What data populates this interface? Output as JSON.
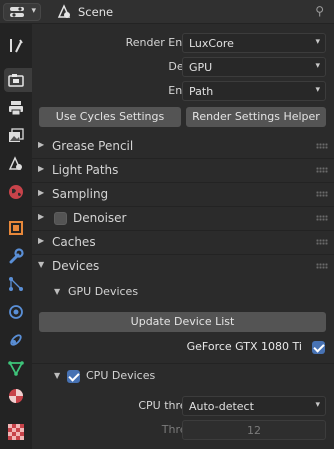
{
  "header": {
    "scene_title": "Scene",
    "editor_icon": "properties-editor-icon",
    "context_icon": "scene-icon",
    "pin_icon": "pin-icon"
  },
  "tabs": [
    {
      "name": "tool-tab",
      "icon": "wrench-screwdriver-icon"
    },
    {
      "name": "render-tab",
      "icon": "camera-back-icon",
      "active": true
    },
    {
      "name": "output-tab",
      "icon": "printer-icon"
    },
    {
      "name": "view-layer-tab",
      "icon": "image-stack-icon"
    },
    {
      "name": "scene-tab",
      "icon": "scene-icon"
    },
    {
      "name": "world-tab",
      "icon": "world-icon"
    },
    {
      "name": "object-tab",
      "icon": "object-square-icon"
    },
    {
      "name": "modifier-tab",
      "icon": "wrench-icon"
    },
    {
      "name": "particles-tab",
      "icon": "particles-icon"
    },
    {
      "name": "physics-tab",
      "icon": "physics-orbit-icon"
    },
    {
      "name": "constraints-tab",
      "icon": "constraint-icon"
    },
    {
      "name": "data-tab",
      "icon": "mesh-data-icon"
    },
    {
      "name": "material-tab",
      "icon": "material-sphere-icon"
    },
    {
      "name": "texture-tab",
      "icon": "checker-texture-icon"
    }
  ],
  "render": {
    "render_engine_label": "Render Engine",
    "render_engine_value": "LuxCore",
    "device_label": "Device",
    "device_value": "GPU",
    "engine_label": "Engine",
    "engine_value": "Path",
    "use_cycles_button": "Use Cycles Settings",
    "helper_button": "Render Settings Helper"
  },
  "sections": {
    "grease_pencil": "Grease Pencil",
    "light_paths": "Light Paths",
    "sampling": "Sampling",
    "denoiser": "Denoiser",
    "caches": "Caches",
    "devices": "Devices"
  },
  "devices": {
    "gpu_devices_title": "GPU Devices",
    "update_button": "Update Device List",
    "gpu_name": "GeForce GTX 1080 Ti",
    "gpu_enabled": true,
    "cpu_devices_title": "CPU Devices",
    "cpu_enabled": true,
    "cpu_threads_label": "CPU threads",
    "cpu_threads_value": "Auto-detect",
    "threads_label": "Threads",
    "threads_value": "12"
  },
  "colors": {
    "accent": "#4772b3",
    "panel": "#2b2b2b",
    "button": "#545454"
  }
}
